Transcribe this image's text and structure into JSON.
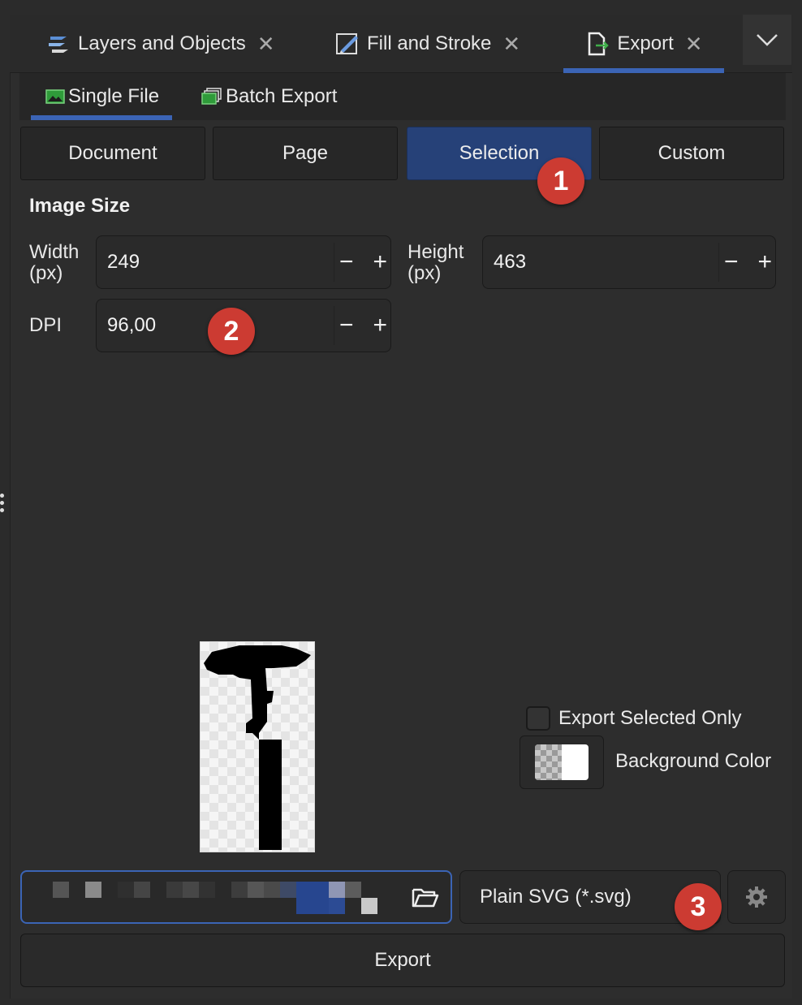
{
  "tabs": [
    {
      "label": "Layers and Objects",
      "icon": "layers-icon"
    },
    {
      "label": "Fill and Stroke",
      "icon": "fill-stroke-icon"
    },
    {
      "label": "Export",
      "icon": "export-icon",
      "active": true
    }
  ],
  "subtabs": [
    {
      "label": "Single File",
      "icon": "image-icon",
      "active": true
    },
    {
      "label": "Batch Export",
      "icon": "batch-export-icon"
    }
  ],
  "modes": [
    "Document",
    "Page",
    "Selection",
    "Custom"
  ],
  "active_mode": "Selection",
  "image_size": {
    "title": "Image Size",
    "width_label_1": "Width",
    "width_label_2": "(px)",
    "width_value": "249",
    "height_label_1": "Height",
    "height_label_2": "(px)",
    "height_value": "463",
    "dpi_label": "DPI",
    "dpi_value": "96,00"
  },
  "stepper": {
    "minus": "−",
    "plus": "+"
  },
  "badges": [
    "1",
    "2",
    "3"
  ],
  "options": {
    "export_selected_only": "Export Selected Only",
    "background_color": "Background Color"
  },
  "format": "Plain SVG (*.svg)",
  "export_label": "Export",
  "colors": {
    "accent": "#3b64b5",
    "badge": "#cc3b32",
    "active_segment": "#264178"
  }
}
